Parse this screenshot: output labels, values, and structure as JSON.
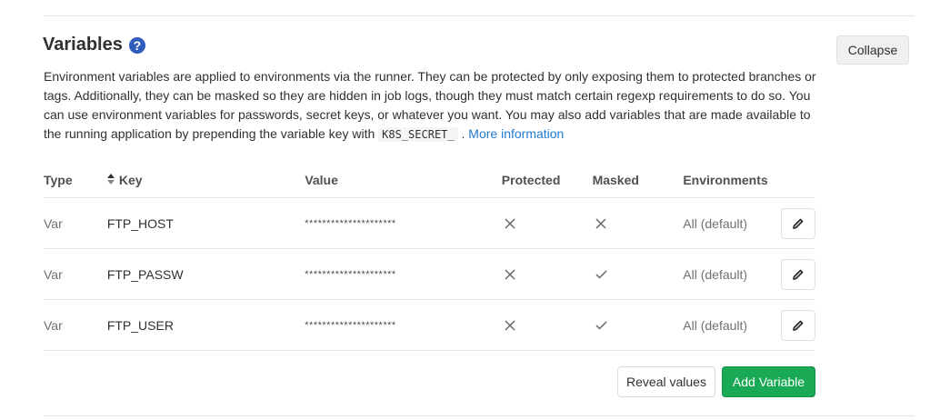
{
  "section": {
    "title": "Variables",
    "help_icon": "question-circle-icon",
    "collapse_label": "Collapse"
  },
  "description": {
    "text_before": "Environment variables are applied to environments via the runner. They can be protected by only exposing them to protected branches or tags. Additionally, they can be masked so they are hidden in job logs, though they must match certain regexp requirements to do so. You can use environment variables for passwords, secret keys, or whatever you want. You may also add variables that are made available to the running application by prepending the variable key with",
    "code": "K8S_SECRET_",
    "text_after": ".",
    "link": "More information"
  },
  "table": {
    "headers": {
      "type": "Type",
      "key": "Key",
      "value": "Value",
      "protected": "Protected",
      "masked": "Masked",
      "environments": "Environments"
    },
    "rows": [
      {
        "type": "Var",
        "key": "FTP_HOST",
        "value": "*********************",
        "protected": false,
        "masked": false,
        "environments": "All (default)"
      },
      {
        "type": "Var",
        "key": "FTP_PASSW",
        "value": "*********************",
        "protected": false,
        "masked": true,
        "environments": "All (default)"
      },
      {
        "type": "Var",
        "key": "FTP_USER",
        "value": "*********************",
        "protected": false,
        "masked": true,
        "environments": "All (default)"
      }
    ]
  },
  "actions": {
    "reveal_label": "Reveal values",
    "add_label": "Add Variable"
  },
  "colors": {
    "primary_green": "#1aaa55",
    "link_blue": "#1f78d1"
  }
}
